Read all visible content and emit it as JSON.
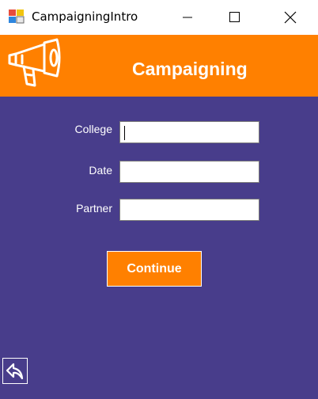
{
  "window": {
    "title": "CampaigningIntro",
    "app_icon": "winforms-app-icon"
  },
  "header": {
    "title": "Campaigning",
    "icon": "megaphone-icon",
    "background": "#ff8000"
  },
  "form": {
    "background": "#483d8b",
    "fields": [
      {
        "label": "College",
        "value": ""
      },
      {
        "label": "Date",
        "value": ""
      },
      {
        "label": "Partner",
        "value": ""
      }
    ],
    "continue_label": "Continue",
    "back_icon": "back-arrow-icon"
  },
  "colors": {
    "accent": "#ff8000",
    "panel": "#483d8b",
    "text": "#ffffff"
  }
}
